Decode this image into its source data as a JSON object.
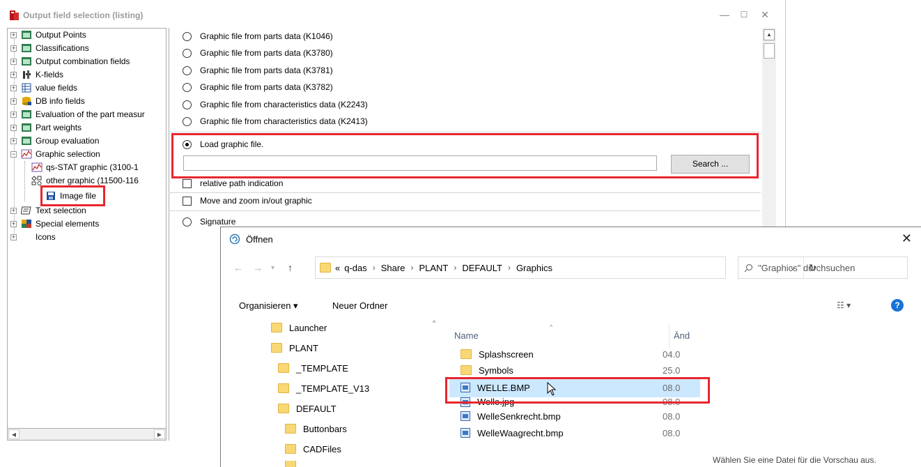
{
  "main_window": {
    "title": "Output field selection (listing)",
    "controls": {
      "minimize": "—",
      "maximize": "☐",
      "close": "✕"
    }
  },
  "tree": {
    "items": [
      {
        "label": "Output Points",
        "icon": "table-icon"
      },
      {
        "label": "Classifications",
        "icon": "table-icon"
      },
      {
        "label": "Output combination fields",
        "icon": "table-icon"
      },
      {
        "label": "K-fields",
        "icon": "k-field-icon"
      },
      {
        "label": "value fields",
        "icon": "grid-icon"
      },
      {
        "label": "DB info fields",
        "icon": "db-icon"
      },
      {
        "label": "Evaluation of the part measur",
        "icon": "table-icon"
      },
      {
        "label": "Part weights",
        "icon": "table-icon"
      },
      {
        "label": "Group evaluation",
        "icon": "table-icon"
      },
      {
        "label": "Graphic selection",
        "icon": "graph-icon",
        "expanded": true
      },
      {
        "label": "qs-STAT graphic (3100-1",
        "icon": "graph-icon",
        "child": true
      },
      {
        "label": "other graphic (11500-116",
        "icon": "shapes-icon",
        "child": true
      },
      {
        "label": "Image file",
        "icon": "disk-icon",
        "child": true,
        "selected": true
      },
      {
        "label": "Text selection",
        "icon": "text-icon"
      },
      {
        "label": "Special elements",
        "icon": "special-icon"
      },
      {
        "label": "Icons",
        "icon": "none"
      }
    ]
  },
  "options": {
    "radios": [
      "Graphic file from parts data (K1046)",
      "Graphic file from parts data (K3780)",
      "Graphic file from parts data (K3781)",
      "Graphic file from parts data (K3782)",
      "Graphic file from characteristics data (K2243)",
      "Graphic file from characteristics data (K2413)"
    ],
    "load_graphic": "Load graphic file.",
    "path_value": "",
    "search_button": "Search ...",
    "relative_path": "relative path indication",
    "move_zoom": "Move and zoom in/out graphic",
    "signature": "Signature"
  },
  "dialog": {
    "title": "Öffnen",
    "breadcrumb": [
      "«",
      "q-das",
      "Share",
      "PLANT",
      "DEFAULT",
      "Graphics"
    ],
    "search_placeholder": "\"Graphics\" durchsuchen",
    "organize": "Organisieren ▾",
    "new_folder": "Neuer Ordner",
    "nav_folders": [
      {
        "label": "Launcher",
        "level": 0
      },
      {
        "label": "PLANT",
        "level": 0
      },
      {
        "label": "_TEMPLATE",
        "level": 1
      },
      {
        "label": "_TEMPLATE_V13",
        "level": 1
      },
      {
        "label": "DEFAULT",
        "level": 1
      },
      {
        "label": "Buttonbars",
        "level": 2
      },
      {
        "label": "CADFiles",
        "level": 2
      }
    ],
    "columns": {
      "name": "Name",
      "date": "Änd"
    },
    "files": [
      {
        "name": "Splashscreen",
        "type": "folder",
        "date": "04.0"
      },
      {
        "name": "Symbols",
        "type": "folder",
        "date": "25.0"
      },
      {
        "name": "WELLE.BMP",
        "type": "bmp",
        "date": "08.0",
        "selected": true
      },
      {
        "name": "Welle.jpg",
        "type": "bmp",
        "date": "08.0"
      },
      {
        "name": "WelleSenkrecht.bmp",
        "type": "bmp",
        "date": "08.0"
      },
      {
        "name": "WelleWaagrecht.bmp",
        "type": "bmp",
        "date": "08.0"
      }
    ],
    "preview_hint": "Wählen Sie eine Datei für die Vorschau aus."
  },
  "colors": {
    "highlight_red": "#e8262d",
    "selection_blue": "#cce8ff",
    "help_blue": "#1a73d9"
  }
}
